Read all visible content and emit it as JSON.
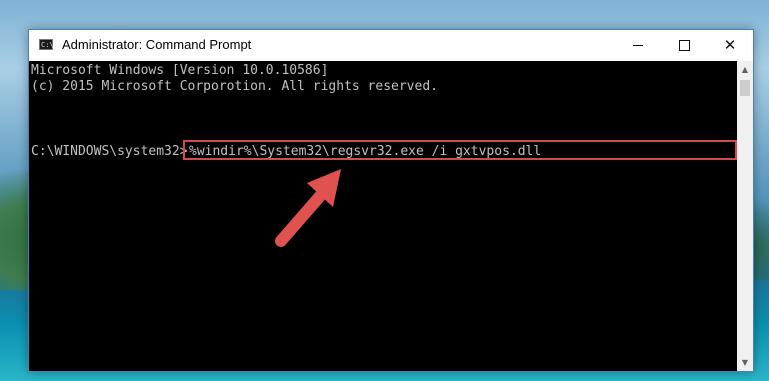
{
  "window": {
    "title": "Administrator: Command Prompt",
    "icon": "cmd-icon",
    "icon_text": "C:\\."
  },
  "controls": {
    "minimize": "minimize-icon",
    "maximize": "maximize-icon",
    "close": "close-icon",
    "close_glyph": "✕"
  },
  "console": {
    "lines": [
      "Microsoft Windows [Version 10.0.10586]",
      "(c) 2015 Microsoft Corporotion. All rights reserved."
    ],
    "prompt": "C:\\WINDOWS\\system32>",
    "command": "%windir%\\System32\\regsvr32.exe /i gxtvpos.dll",
    "highlight_color": "#d34a4a",
    "arrow_color": "#e0524f"
  },
  "scrollbar": {
    "up_glyph": "▲",
    "down_glyph": "▼"
  }
}
